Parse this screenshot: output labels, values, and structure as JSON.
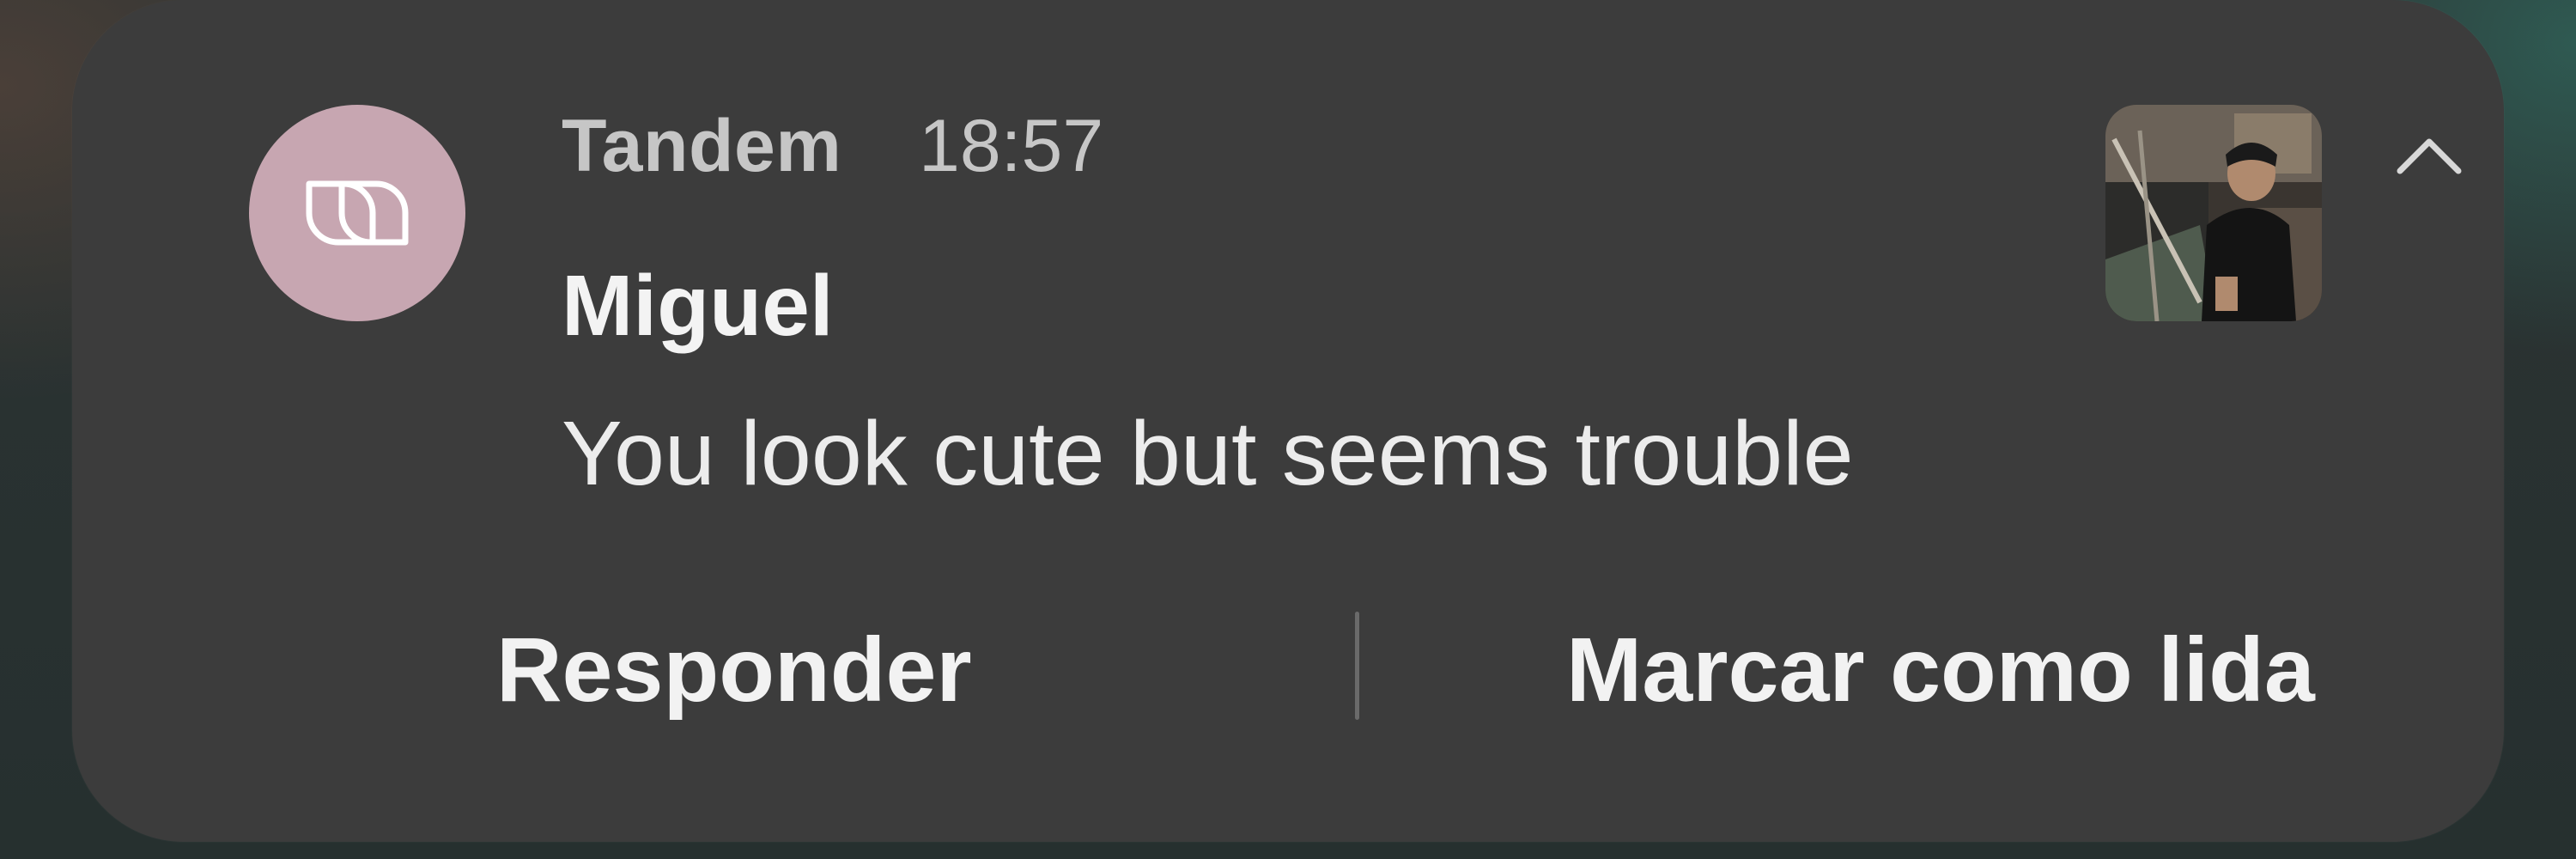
{
  "notification": {
    "app_name": "Tandem",
    "time": "18:57",
    "sender": "Miguel",
    "message": "You look cute but seems trouble",
    "app_icon": "tandem-logo-icon",
    "thumbnail": "contact-photo",
    "collapse_icon": "chevron-up-icon",
    "actions": {
      "reply_label": "Responder",
      "mark_read_label": "Marcar como lida"
    }
  },
  "colors": {
    "card_background": "#3c3c3c",
    "app_icon_background": "#c7a6b1",
    "primary_text": "#f3f3f3",
    "secondary_text": "#c6c6c6"
  }
}
